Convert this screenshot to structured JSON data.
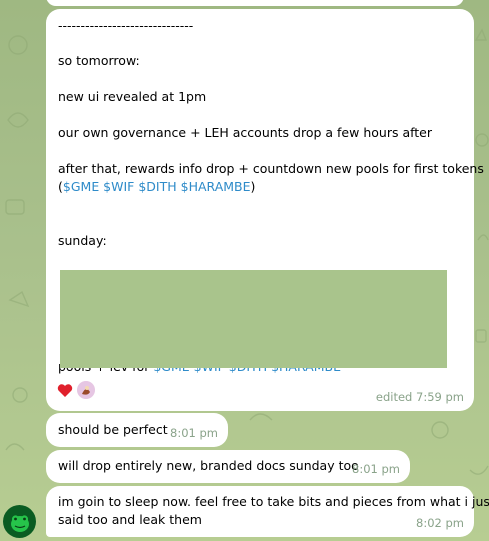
{
  "messages": {
    "top_fragment": {
      "time": ""
    },
    "main": {
      "separator": "------------------------------",
      "line_tomorrow": "so tomorrow:",
      "line_ui": "new ui revealed at 1pm",
      "line_governance": "our own governance + LEH accounts drop a few hours after",
      "line_rewards": "after that, rewards info drop + countdown new pools for first tokens",
      "line_tokens_open": "(",
      "tokens": "$GME $WIF $DITH $HARAMBE",
      "line_tokens_close": ")",
      "line_sunday": "sunday:",
      "line_pools_prefix": "pools + lev for ",
      "line_pools_tokens": "$GME $WIF $DITH $HARAMBE",
      "time": "edited 7:59 pm",
      "reactions": [
        "heart",
        "avatar"
      ]
    },
    "m2": {
      "text": "should be perfect",
      "time": "8:01 pm"
    },
    "m3": {
      "text": "will drop entirely new, branded docs sunday too",
      "time": "8:01 pm"
    },
    "m4": {
      "line1": "im goin to sleep now. feel free to take bits and pieces from what i just",
      "line2": "said too and leak them",
      "time": "8:02 pm"
    }
  },
  "colors": {
    "link": "#2e8bc9",
    "time": "#8aa38a",
    "background": "#a9c08c",
    "redaction": "#a9c48c"
  },
  "icons": {
    "sender_avatar": "green-frog-avatar-icon",
    "reaction_heart": "heart-icon"
  }
}
